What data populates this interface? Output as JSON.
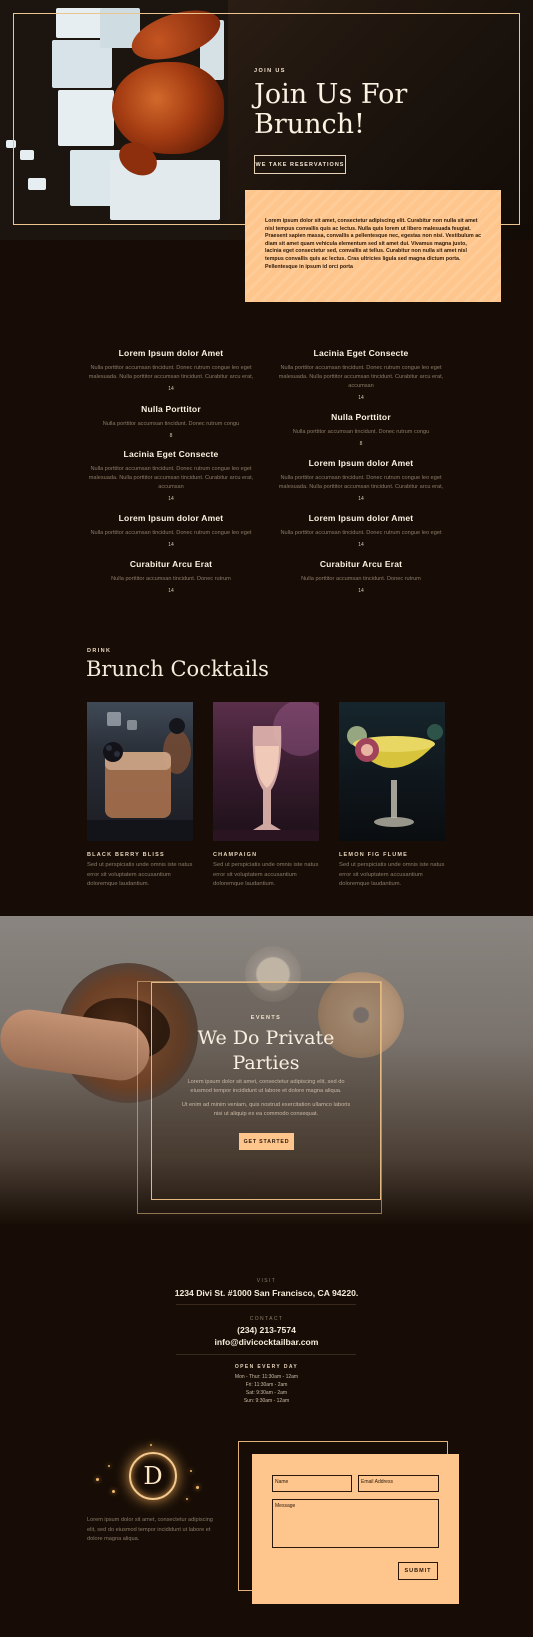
{
  "hero": {
    "kicker": "JOIN US",
    "title_line1": "Join Us For",
    "title_line2": "Brunch!",
    "button_label": "WE TAKE RESERVATIONS",
    "card_text": "Lorem ipsum dolor sit amet, consectetur adipiscing elit. Curabitur non nulla sit amet nisl tempus convallis quis ac lectus. Nulla quis lorem ut libero malesuada feugiat. Praesent sapien massa, convallis a pellentesque nec, egestas non nisi. Vestibulum ac diam sit amet quam vehicula elementum sed sit amet dui. Vivamus magna justo, lacinia eget consectetur sed, convallis at tellus. Curabitur non nulla sit amet nisl tempus convallis quis ac lectus. Cras ultricies ligula sed magna dictum porta. Pellentesque in ipsum id orci porta"
  },
  "menu": {
    "left": [
      {
        "name": "Lorem Ipsum dolor Amet",
        "desc": "Nulla porttitor accumsan tincidunt. Donec rutrum congue leo eget malesuada. Nulla porttitor accumsan tincidunt. Curabitur arcu erat,",
        "price": "14"
      },
      {
        "name": "Nulla Porttitor",
        "desc": "Nulla porttitor accumsan tincidunt. Donec rutrum congu",
        "price": "8"
      },
      {
        "name": "Lacinia Eget Consecte",
        "desc": "Nulla porttitor accumsan tincidunt. Donec rutrum congue leo eget malesuada. Nulla porttitor accumsan tincidunt. Curabitur arcu erat, accumsan",
        "price": "14"
      },
      {
        "name": "Lorem Ipsum dolor Amet",
        "desc": "Nulla porttitor accumsan tincidunt. Donec rutrum congue leo eget",
        "price": "14"
      },
      {
        "name": "Curabitur Arcu Erat",
        "desc": "Nulla porttitor accumsan tincidunt. Donec rutrum",
        "price": "14"
      }
    ],
    "right": [
      {
        "name": "Lacinia Eget Consecte",
        "desc": "Nulla porttitor accumsan tincidunt. Donec rutrum congue leo eget malesuada. Nulla porttitor accumsan tincidunt. Curabitur arcu erat, accumsan",
        "price": "14"
      },
      {
        "name": "Nulla Porttitor",
        "desc": "Nulla porttitor accumsan tincidunt. Donec rutrum congu",
        "price": "8"
      },
      {
        "name": "Lorem Ipsum dolor Amet",
        "desc": "Nulla porttitor accumsan tincidunt. Donec rutrum congue leo eget malesuada. Nulla porttitor accumsan tincidunt. Curabitur arcu erat,",
        "price": "14"
      },
      {
        "name": "Lorem Ipsum dolor Amet",
        "desc": "Nulla porttitor accumsan tincidunt. Donec rutrum congue leo eget",
        "price": "14"
      },
      {
        "name": "Curabitur Arcu Erat",
        "desc": "Nulla porttitor accumsan tincidunt. Donec rutrum",
        "price": "14"
      }
    ]
  },
  "cocktails": {
    "kicker": "DRINK",
    "title": "Brunch Cocktails",
    "items": [
      {
        "name": "BLACK BERRY BLISS",
        "desc": "Sed ut perspiciatis unde omnis iste natus error sit voluptatem accusantium doloremque laudantium.",
        "icon": "whiskey-glass-photo"
      },
      {
        "name": "CHAMPAIGN",
        "desc": "Sed ut perspiciatis unde omnis iste natus error sit voluptatem accusantium doloremque laudantium.",
        "icon": "champagne-flute-photo"
      },
      {
        "name": "LEMON FIG FLUME",
        "desc": "Sed ut perspiciatis unde omnis iste natus error sit voluptatem accusantium doloremque laudantium.",
        "icon": "coupe-glass-photo"
      }
    ]
  },
  "events": {
    "kicker": "EVENTS",
    "title_line1": "We Do Private",
    "title_line2": "Parties",
    "para1": "Lorem ipsum dolor sit amet, consectetur adipiscing elit, sed do eiusmod tempor incididunt ut labore et dolore magna aliqua.",
    "para2": "Ut enim ad minim veniam, quis nostrud exercitation ullamco laboris nisi ut aliquip ex ea commodo consequat.",
    "button_label": "GET STARTED"
  },
  "contact": {
    "visit_label": "VISIT",
    "address": "1234 Divi St. #1000 San Francisco, CA 94220.",
    "contact_label": "CONTACT",
    "phone": "(234) 213-7574",
    "email": "info@divicocktailbar.com",
    "hours_label": "OPEN EVERY DAY",
    "hours": [
      "Mon - Thur: 11:30am - 12am",
      "Fri: 11:30am - 2am",
      "Sat: 9:30am - 2am",
      "Sun: 9:30am - 12am"
    ]
  },
  "footer": {
    "logo_letter": "D",
    "text": "Lorem ipsum dolor sit amet, consectetur adipiscing elit, sed do eiusmod tempor incididunt ut labore et dolore magna aliqua."
  },
  "form": {
    "name_placeholder": "Name",
    "email_placeholder": "Email Address",
    "message_placeholder": "Message",
    "submit_label": "SUBMIT"
  },
  "colors": {
    "background": "#170d06",
    "accent": "#fec68d",
    "frame": "#ecc48e",
    "text_light": "#fbf2e2"
  }
}
